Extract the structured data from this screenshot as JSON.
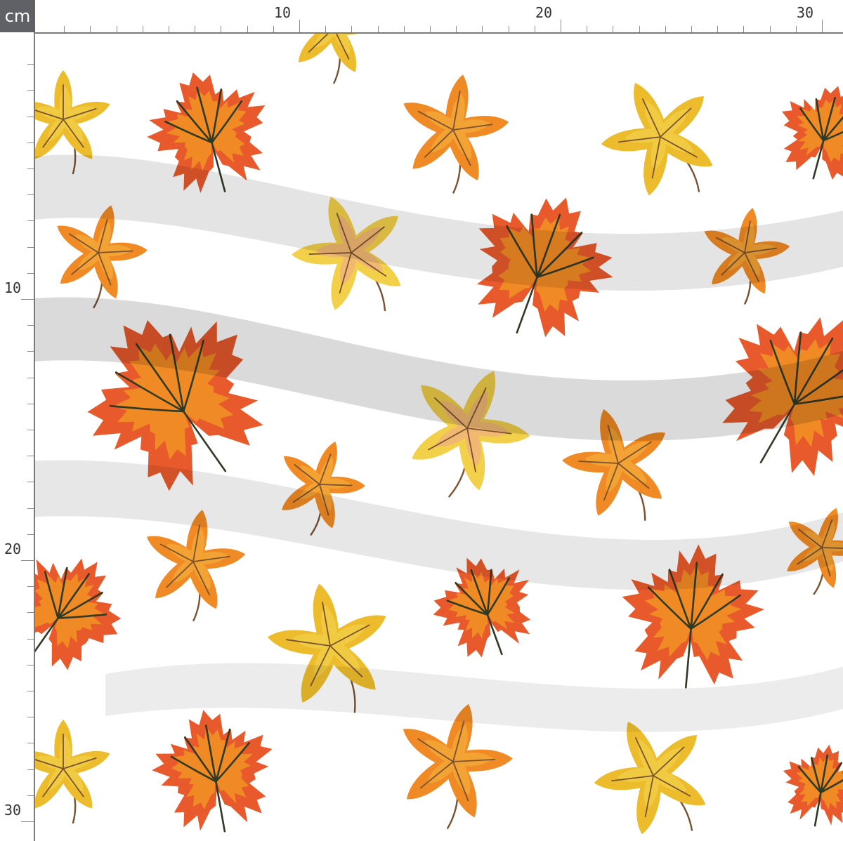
{
  "ruler": {
    "unit": "cm",
    "top_labels": [
      "10",
      "20",
      "30"
    ],
    "left_labels": [
      "10",
      "20",
      "30"
    ]
  },
  "fabric": {
    "background": "#ffffff",
    "colors": {
      "red_orange": "#e85a2c",
      "orange": "#f08a24",
      "amber": "#f4a93a",
      "yellow": "#ecbc2c",
      "pale_yellow": "#f2d04a",
      "peach": "#f0b080",
      "vein_dark": "#2f3a24",
      "vein_brown": "#7a5230"
    }
  }
}
